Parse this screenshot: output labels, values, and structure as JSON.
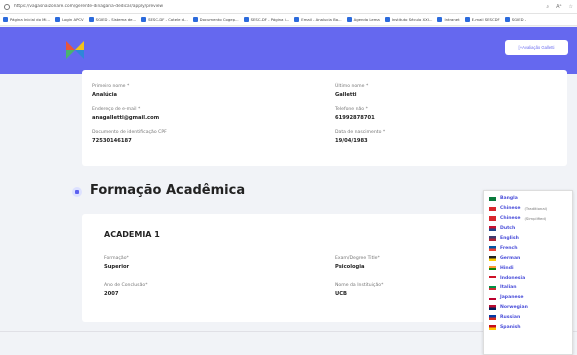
{
  "browser": {
    "url": "https://vagasnaizonare.com/gerente-dinagaria-dedicar/apply/preview"
  },
  "bookmarks": [
    "Página Inicial do Mi...",
    "Login APCV",
    "SGIED - Sistema de...",
    "SESC-DF - Cotele d...",
    "Documento Cogep...",
    "SESC-DF - Página i...",
    "Email - Analucia Ba...",
    "Agenda Lema",
    "Instituto Século XXI...",
    "Intranet",
    "E-mail SESCDF",
    "SGIED -"
  ],
  "header": {
    "evaluate_button": "[+Avaliação Galletti"
  },
  "personal": {
    "first_name_label": "Primeiro nome *",
    "first_name": "Analúcia",
    "last_name_label": "Último nome *",
    "last_name": "Galletti",
    "email_label": "Endereço de e-mail *",
    "email": "anagalletti@gmail.com",
    "phone_label": "Telefone não *",
    "phone": "61992878701",
    "doc_label": "Documento de identificação CPF",
    "doc": "72530146187",
    "birth_label": "Data de nascimento *",
    "birth": "19/04/1983"
  },
  "section": {
    "title": "Formação Acadêmica"
  },
  "academia": {
    "title": "ACADEMIA 1",
    "formation_label": "Formação*",
    "formation": "Superior",
    "degree_label": "Exam/Degree Title*",
    "degree": "Psicologia",
    "year_label": "Ano de Conclusão*",
    "year": "2007",
    "institution_label": "Nome da Instituição*",
    "institution": "UCB"
  },
  "languages": [
    {
      "name": "Bangla",
      "note": "",
      "flag": [
        "#0a7a3c",
        "#0a7a3c"
      ]
    },
    {
      "name": "Chinese",
      "note": "(Traditional)",
      "flag": [
        "#d9262b",
        "#d9262b"
      ]
    },
    {
      "name": "Chinese",
      "note": "(Simplified)",
      "flag": [
        "#d9262b",
        "#d9262b"
      ]
    },
    {
      "name": "Dutch",
      "note": "",
      "flag": [
        "#c8102e",
        "#21468b"
      ]
    },
    {
      "name": "English",
      "note": "",
      "flag": [
        "#3c3b6e",
        "#b22234"
      ]
    },
    {
      "name": "French",
      "note": "",
      "flag": [
        "#0055a4",
        "#ef4135"
      ]
    },
    {
      "name": "German",
      "note": "",
      "flag": [
        "#222222",
        "#ffce00"
      ]
    },
    {
      "name": "Hindi",
      "note": "",
      "flag": [
        "#ff9933",
        "#138808"
      ]
    },
    {
      "name": "Indonesia",
      "note": "",
      "flag": [
        "#ce1126",
        "#ffffff"
      ]
    },
    {
      "name": "Italian",
      "note": "",
      "flag": [
        "#009246",
        "#ce2b37"
      ]
    },
    {
      "name": "Japanese",
      "note": "",
      "flag": [
        "#ffffff",
        "#bc002d"
      ]
    },
    {
      "name": "Norwegian",
      "note": "",
      "flag": [
        "#ba0c2f",
        "#00205b"
      ]
    },
    {
      "name": "Russian",
      "note": "",
      "flag": [
        "#0039a6",
        "#d52b1e"
      ]
    },
    {
      "name": "Spanish",
      "note": "",
      "flag": [
        "#c60b1e",
        "#ffc400"
      ]
    }
  ]
}
